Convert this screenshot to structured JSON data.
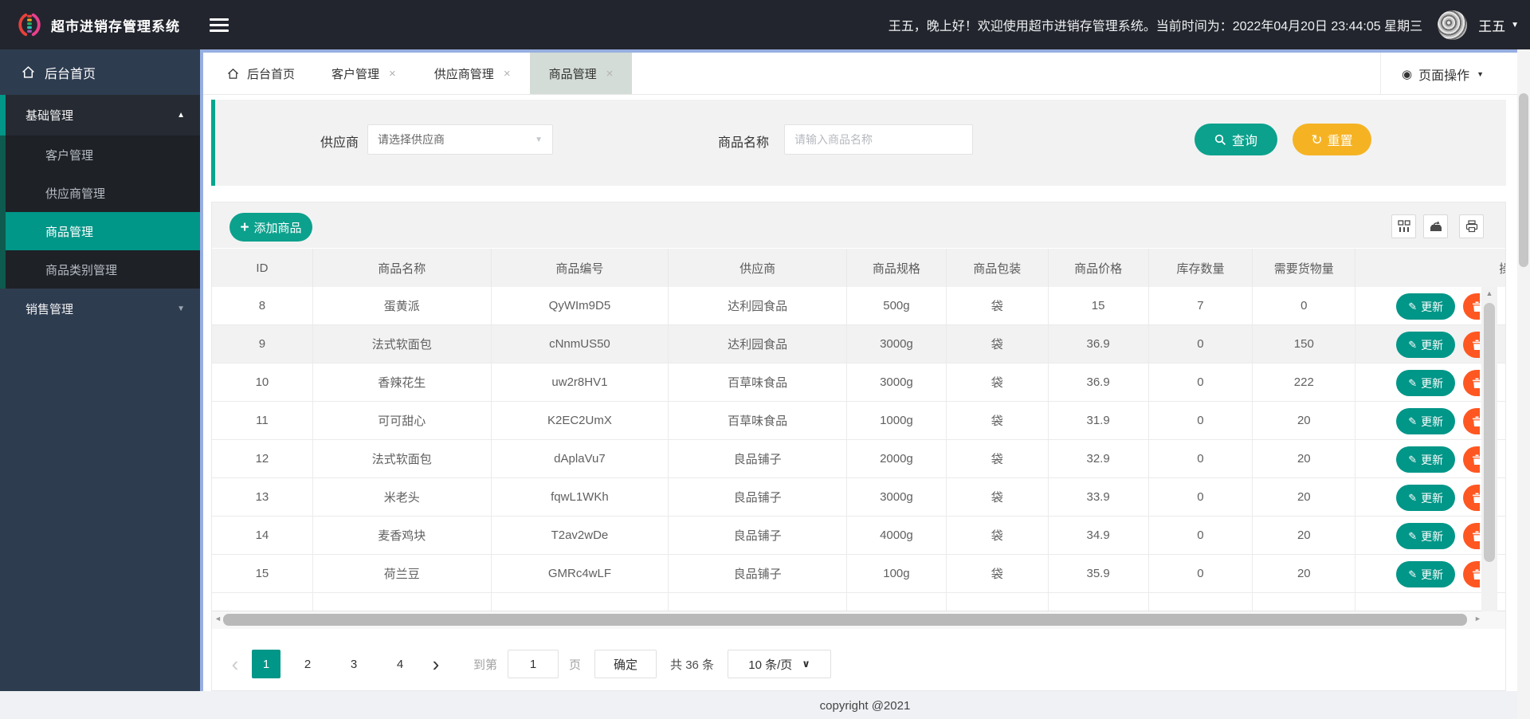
{
  "topbar": {
    "app_title": "超市进销存管理系统",
    "welcome": "王五，晚上好！欢迎使用超市进销存管理系统。当前时间为：2022年04月20日 23:44:05 星期三",
    "username": "王五"
  },
  "sidebar": {
    "home_label": "后台首页",
    "group_basic": "基础管理",
    "group_sales": "销售管理",
    "items": [
      "客户管理",
      "供应商管理",
      "商品管理",
      "商品类别管理"
    ],
    "active_item": "商品管理"
  },
  "tabs": {
    "home": "后台首页",
    "items": [
      "客户管理",
      "供应商管理",
      "商品管理"
    ],
    "active": "商品管理",
    "page_actions": "页面操作"
  },
  "filters": {
    "supplier_label": "供应商",
    "supplier_placeholder": "请选择供应商",
    "product_label": "商品名称",
    "product_placeholder": "请输入商品名称",
    "search_label": "查询",
    "reset_label": "重置"
  },
  "toolbar": {
    "add_button": "添加商品"
  },
  "table": {
    "columns": [
      "ID",
      "商品名称",
      "商品编号",
      "供应商",
      "商品规格",
      "商品包装",
      "商品价格",
      "库存数量",
      "需要货物量",
      "操作"
    ],
    "update_button": "更新",
    "delete_button": "删除",
    "rows": [
      {
        "id": "8",
        "name": "蛋黄派",
        "code": "QyWIm9D5",
        "supplier": "达利园食品",
        "spec": "500g",
        "pack": "袋",
        "price": "15",
        "stock": "7",
        "need": "0",
        "highlight": false
      },
      {
        "id": "9",
        "name": "法式软面包",
        "code": "cNnmUS50",
        "supplier": "达利园食品",
        "spec": "3000g",
        "pack": "袋",
        "price": "36.9",
        "stock": "0",
        "need": "150",
        "highlight": true
      },
      {
        "id": "10",
        "name": "香辣花生",
        "code": "uw2r8HV1",
        "supplier": "百草味食品",
        "spec": "3000g",
        "pack": "袋",
        "price": "36.9",
        "stock": "0",
        "need": "222",
        "highlight": false
      },
      {
        "id": "11",
        "name": "可可甜心",
        "code": "K2EC2UmX",
        "supplier": "百草味食品",
        "spec": "1000g",
        "pack": "袋",
        "price": "31.9",
        "stock": "0",
        "need": "20",
        "highlight": false
      },
      {
        "id": "12",
        "name": "法式软面包",
        "code": "dAplaVu7",
        "supplier": "良品铺子",
        "spec": "2000g",
        "pack": "袋",
        "price": "32.9",
        "stock": "0",
        "need": "20",
        "highlight": false
      },
      {
        "id": "13",
        "name": "米老头",
        "code": "fqwL1WKh",
        "supplier": "良品铺子",
        "spec": "3000g",
        "pack": "袋",
        "price": "33.9",
        "stock": "0",
        "need": "20",
        "highlight": false
      },
      {
        "id": "14",
        "name": "麦香鸡块",
        "code": "T2av2wDe",
        "supplier": "良品铺子",
        "spec": "4000g",
        "pack": "袋",
        "price": "34.9",
        "stock": "0",
        "need": "20",
        "highlight": false
      },
      {
        "id": "15",
        "name": "荷兰豆",
        "code": "GMRc4wLF",
        "supplier": "良品铺子",
        "spec": "100g",
        "pack": "袋",
        "price": "35.9",
        "stock": "0",
        "need": "20",
        "highlight": false
      }
    ]
  },
  "pagination": {
    "pages": [
      "1",
      "2",
      "3",
      "4"
    ],
    "active_page": "1",
    "goto_label": "到第",
    "goto_value": "1",
    "page_unit": "页",
    "confirm_label": "确定",
    "total_label": "共 36 条",
    "page_size": "10 条/页"
  },
  "footer": {
    "copyright": "copyright @2021"
  },
  "icons": {
    "chevron_up": "▲",
    "chevron_down": "▼",
    "caret_down": "▼",
    "close": "×",
    "prev": "‹",
    "next": "›",
    "scroll_up": "▲",
    "scroll_left": "◄",
    "scroll_right": "►",
    "plus": "+",
    "pencil": "✎",
    "refresh": "↻",
    "dot_circle": "◉",
    "vee": "∨"
  },
  "colors": {
    "accent_teal": "#009688",
    "accent_yellow": "#f5b324",
    "accent_orange": "#ff5722",
    "accent_blue": "#97afe0"
  }
}
